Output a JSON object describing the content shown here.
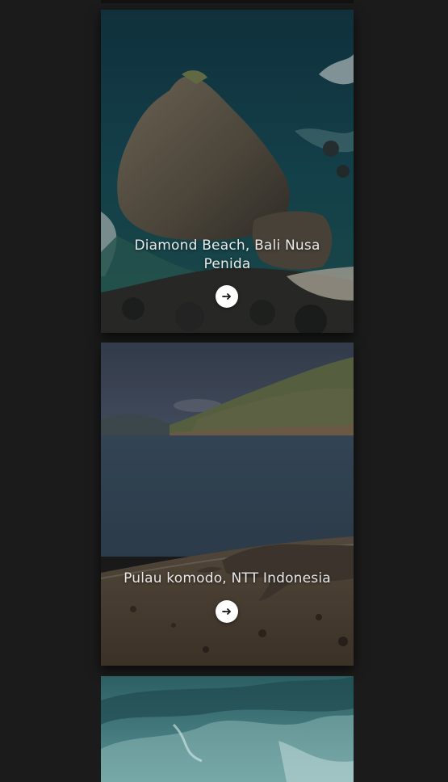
{
  "cards": [
    {
      "title": "Diamond Beach, Bali Nusa Penida",
      "button_icon": "arrow-right-icon"
    },
    {
      "title": "Pulau komodo, NTT Indonesia",
      "button_icon": "arrow-right-icon"
    }
  ],
  "colors": {
    "page_background": "#1b1b1b",
    "title_text": "#e9e9e9",
    "button_background": "#ffffff",
    "button_icon": "#1b1b1b"
  }
}
